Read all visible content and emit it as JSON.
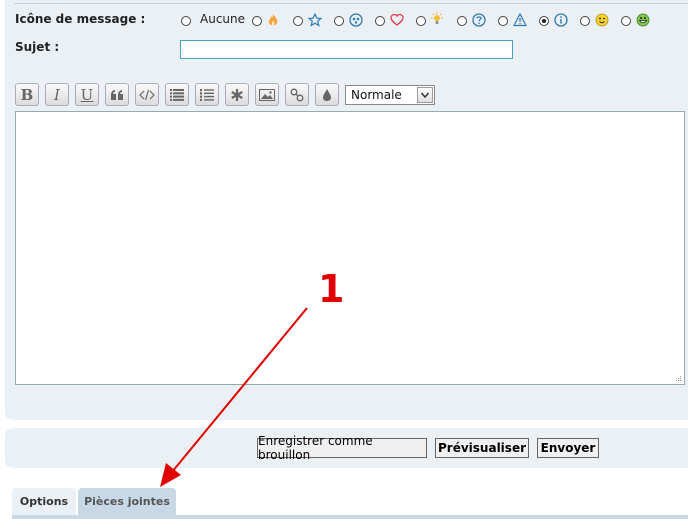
{
  "form": {
    "icon_label": "Icône de message :",
    "subject_label": "Sujet :",
    "subject_value": "",
    "icons": [
      {
        "name": "none",
        "label": "Aucune",
        "checked": false
      },
      {
        "name": "fire-icon",
        "checked": false
      },
      {
        "name": "star-icon",
        "checked": false
      },
      {
        "name": "alien-face-icon",
        "checked": false
      },
      {
        "name": "heart-icon",
        "checked": false
      },
      {
        "name": "lightbulb-icon",
        "checked": false
      },
      {
        "name": "question-icon",
        "checked": false
      },
      {
        "name": "warning-icon",
        "checked": false
      },
      {
        "name": "info-icon",
        "checked": true
      },
      {
        "name": "wink-smiley-icon",
        "checked": false
      },
      {
        "name": "grin-smiley-icon",
        "checked": false
      }
    ]
  },
  "toolbar": {
    "buttons": [
      "bold-icon",
      "italic-icon",
      "underline-icon",
      "quote-icon",
      "code-icon",
      "list-icon",
      "ordered-list-icon",
      "asterisk-icon",
      "image-icon",
      "link-icon",
      "color-drop-icon"
    ],
    "bold_glyph": "B",
    "italic_glyph": "I",
    "underline_glyph": "U",
    "size_value": "Normale"
  },
  "actions": {
    "draft_label": "Enregistrer comme brouillon",
    "preview_label": "Prévisualiser",
    "send_label": "Envoyer"
  },
  "tabs": {
    "options_label": "Options",
    "attachments_label": "Pièces jointes"
  },
  "annotation": {
    "number": "1",
    "color": "#e00000"
  }
}
